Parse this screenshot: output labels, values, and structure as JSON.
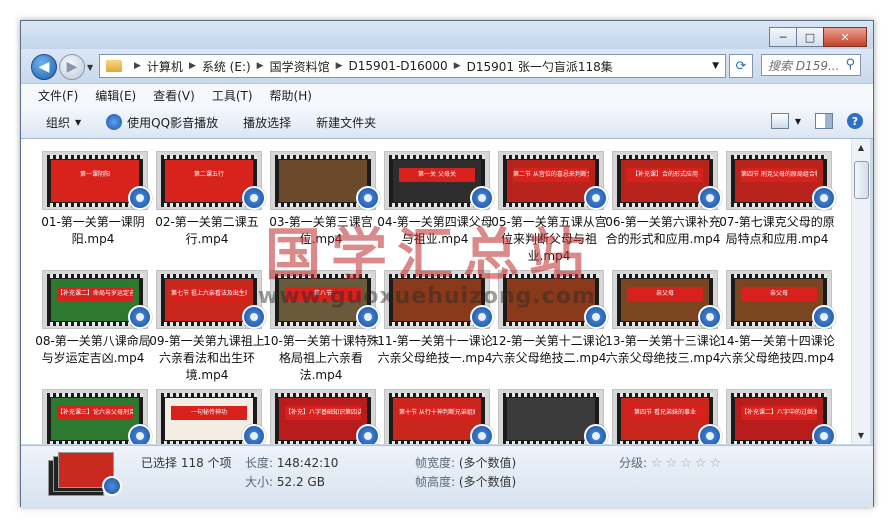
{
  "address": {
    "crumbs": [
      "计算机",
      "系统 (E:)",
      "国学资料馆",
      "D15901-D16000",
      "D15901 张一勺盲派118集"
    ],
    "search_placeholder": "搜索 D159..."
  },
  "window_buttons": {
    "minimize": "─",
    "maximize": "□",
    "close": "✕"
  },
  "menubar": [
    "文件(F)",
    "编辑(E)",
    "查看(V)",
    "工具(T)",
    "帮助(H)"
  ],
  "toolbar": {
    "organize": "组织",
    "play_qq": "使用QQ影音播放",
    "play_selection": "播放选择",
    "new_folder": "新建文件夹"
  },
  "files": [
    {
      "name": "01-第一关第一课阴阳.mp4",
      "band": "第一课阴阳"
    },
    {
      "name": "02-第一关第二课五行.mp4",
      "band": "第二课五行"
    },
    {
      "name": "03-第一关第三课宫位.mp4",
      "band": ""
    },
    {
      "name": "04-第一关第四课父母与祖业.mp4",
      "band": "第一关 父母关"
    },
    {
      "name": "05-第一关第五课从宫位来判断父母与祖业.mp4",
      "band": "第二节 从宫位的喜忌来判断父母"
    },
    {
      "name": "06-第一关第六课补充合的形式和应用.mp4",
      "band": "【补充课】合的形式应用"
    },
    {
      "name": "07-第七课克父母的原局特点和应用.mp4",
      "band": "第四节 刑克父母的原局组合特点"
    },
    {
      "name": "08-第一关第八课命局与岁运定吉凶.mp4",
      "band": "【补充课二】命局与岁运定吉凶"
    },
    {
      "name": "09-第一关第九课祖上六亲看法和出生环境.mp4",
      "band": "第七节 祖上六亲看法及出生环境"
    },
    {
      "name": "10-第一关第十课特殊格局祖上六亲看法.mp4",
      "band": "第八节"
    },
    {
      "name": "11-第一关第十一课论六亲父母绝技一.mp4",
      "band": ""
    },
    {
      "name": "12-第一关第十二课论六亲父母绝技二.mp4",
      "band": ""
    },
    {
      "name": "13-第一关第十三课论六亲父母绝技三.mp4",
      "band": "亲父母"
    },
    {
      "name": "14-第一关第十四课论六亲父母绝技四.mp4",
      "band": "亲父母"
    },
    {
      "name": "",
      "band": "【补充课三】论六亲父母刑克"
    },
    {
      "name": "",
      "band": "一句秘传神功"
    },
    {
      "name": "",
      "band": "【补充】八字基础知识第四讲"
    },
    {
      "name": "",
      "band": "第十节 从行十神判断兄弟姐妹"
    },
    {
      "name": "",
      "band": ""
    },
    {
      "name": "",
      "band": "第四节 看兄弟妹的事业"
    },
    {
      "name": "",
      "band": "【补充课二】八字中的过继关系"
    }
  ],
  "watermark": {
    "cn": "国学汇总站",
    "url": "www.guoxuehuizong.com"
  },
  "details": {
    "selected": "已选择 118 个项",
    "length_label": "长度:",
    "length_value": "148:42:10",
    "size_label": "大小:",
    "size_value": "52.2 GB",
    "frame_width_label": "帧宽度:",
    "frame_width_value": "(多个数值)",
    "frame_height_label": "帧高度:",
    "frame_height_value": "(多个数值)",
    "rating_label": "分级:",
    "rating_stars": 0
  }
}
